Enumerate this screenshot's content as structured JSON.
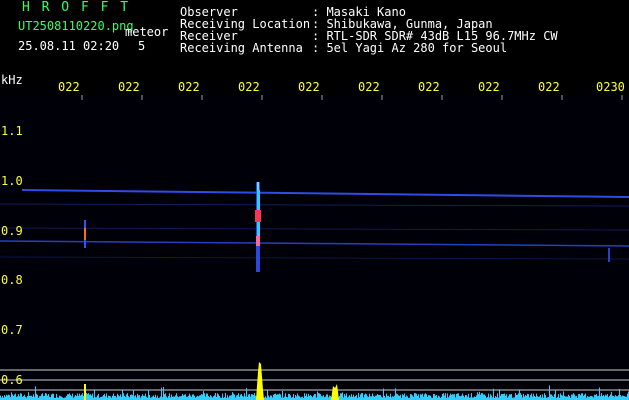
{
  "header": {
    "app_name": "H R O F F T",
    "filename": "UT2508110220.png",
    "tag": "meteor",
    "datetime": "25.08.11 02:20",
    "interval": "5",
    "meta": [
      {
        "label": "Observer",
        "value": ": Masaki Kano"
      },
      {
        "label": "Receiving Location",
        "value": ": Shibukawa, Gunma, Japan"
      },
      {
        "label": "Receiver",
        "value": ": RTL-SDR SDR# 43dB L15 96.7MHz CW"
      },
      {
        "label": "Receiving Antenna",
        "value": ": 5el Yagi Az 280 for Seoul"
      }
    ]
  },
  "axis": {
    "y_unit": "kHz",
    "y_ticks": [
      "1.1",
      "1.0",
      "0.9",
      "0.8",
      "0.7",
      "0.6"
    ],
    "x_ticks": [
      "022",
      "022",
      "022",
      "022",
      "022",
      "022",
      "022",
      "022",
      "022",
      "0230"
    ]
  },
  "colors": {
    "text": "#ffffff",
    "axis_labels": "#ffff33",
    "app_name": "#33ff66",
    "background": "#000000",
    "carrier": "#3355ff",
    "meteor_core": "#ff3355",
    "meteor_mid": "#33ccff",
    "signal_trace": "#33ccff",
    "signal_peak": "#ffff00"
  }
}
